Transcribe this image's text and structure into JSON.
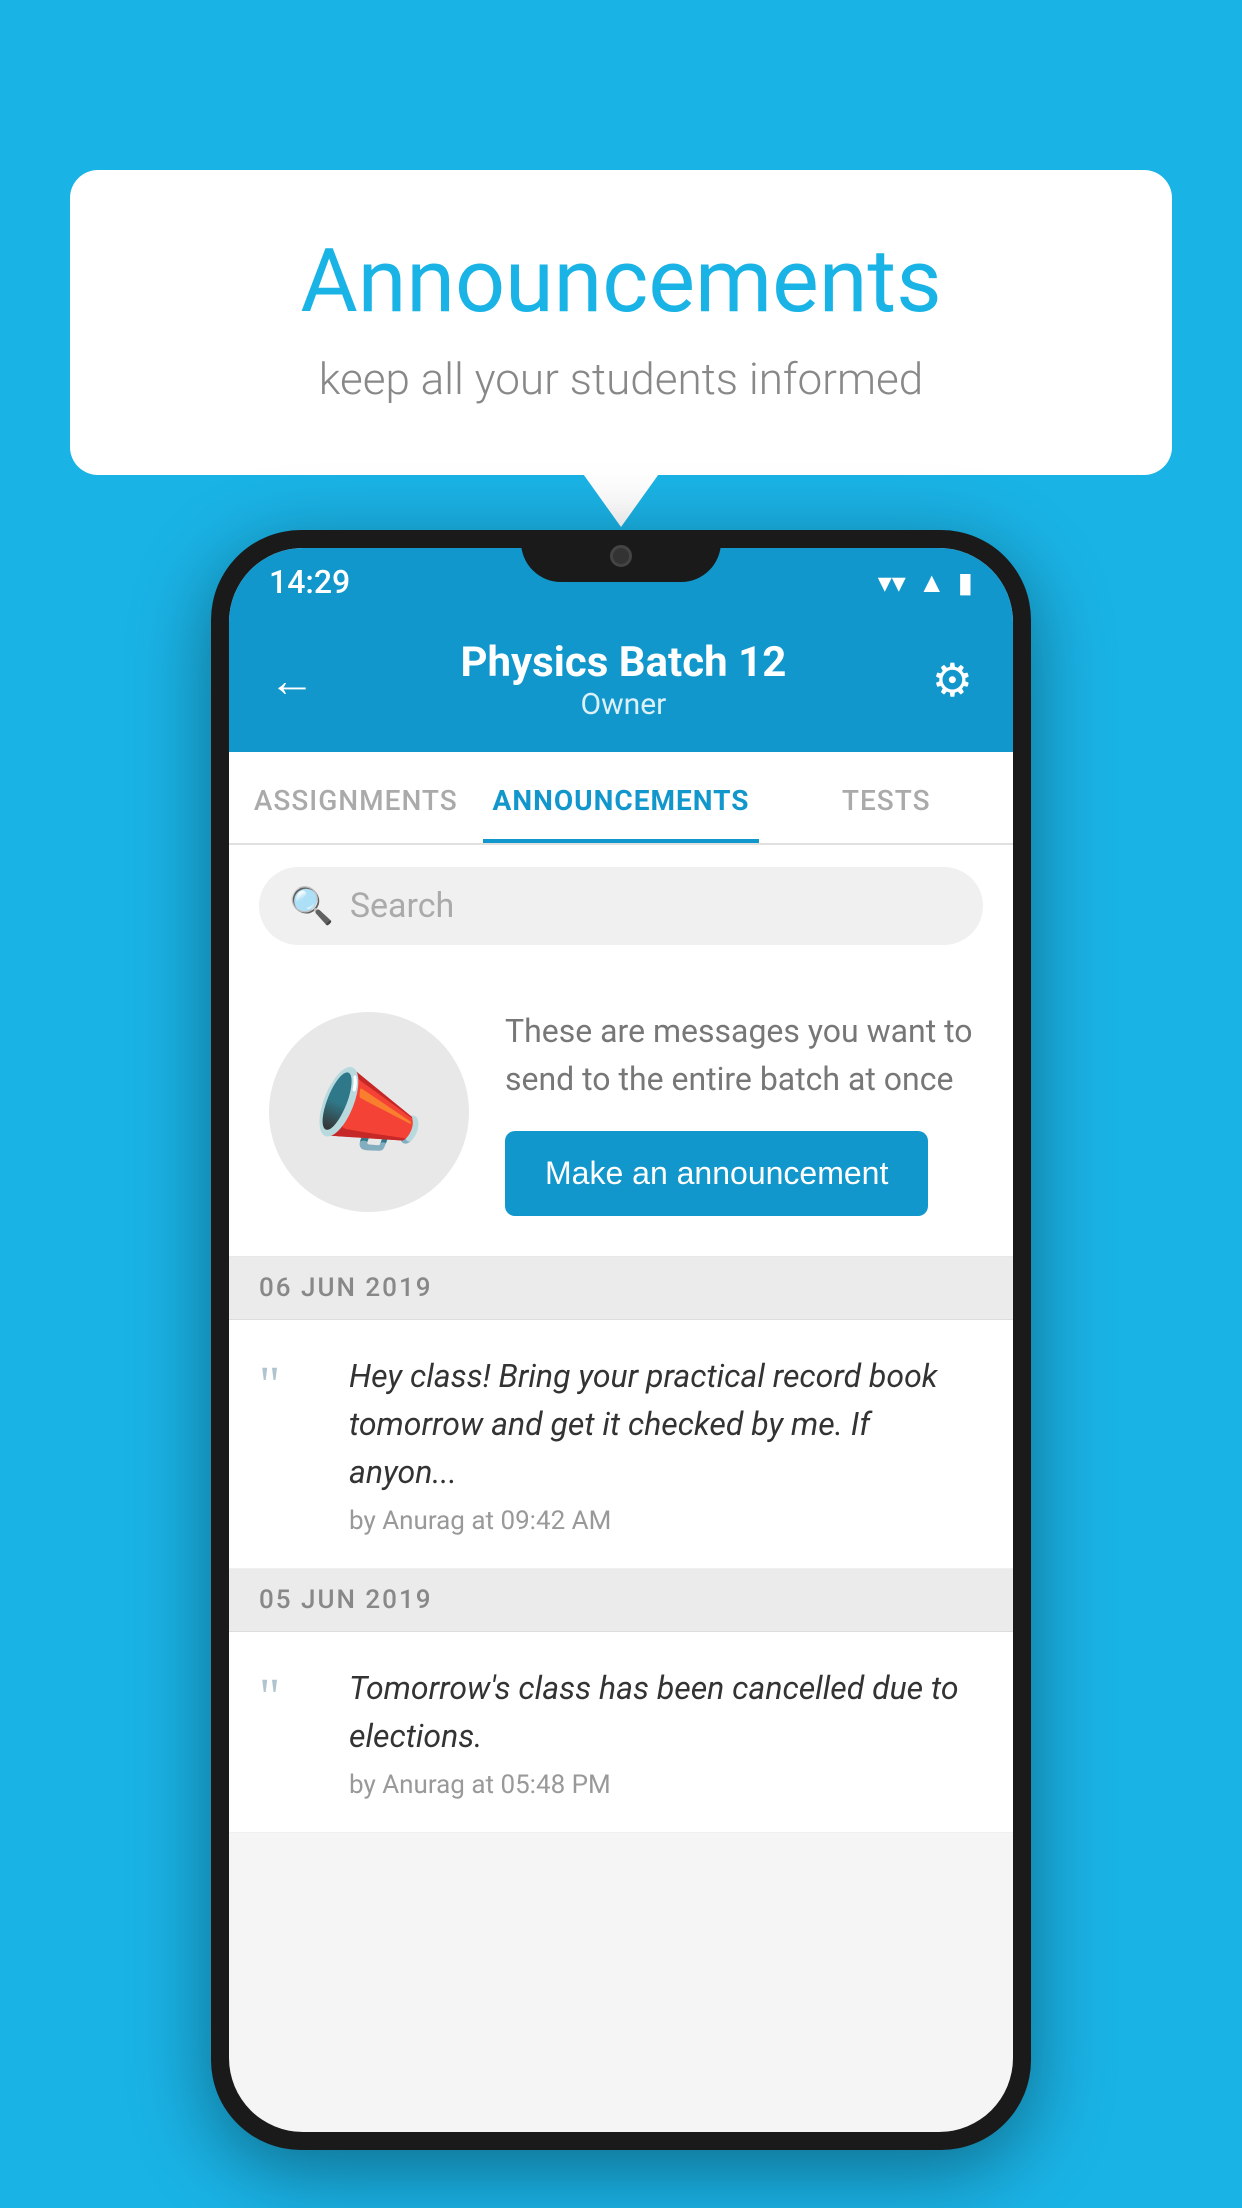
{
  "background_color": "#1ab3e6",
  "speech_bubble": {
    "title": "Announcements",
    "subtitle": "keep all your students informed"
  },
  "phone": {
    "status_bar": {
      "time": "14:29",
      "icons": [
        "wifi",
        "signal",
        "battery"
      ]
    },
    "header": {
      "back_icon": "←",
      "title": "Physics Batch 12",
      "subtitle": "Owner",
      "gear_icon": "⚙"
    },
    "tabs": [
      {
        "label": "ASSIGNMENTS",
        "active": false
      },
      {
        "label": "ANNOUNCEMENTS",
        "active": true
      },
      {
        "label": "TESTS",
        "active": false
      },
      {
        "label": "",
        "active": false
      }
    ],
    "search": {
      "placeholder": "Search"
    },
    "promo": {
      "description": "These are messages you want to send to the entire batch at once",
      "button_label": "Make an announcement"
    },
    "announcements": [
      {
        "date": "06  JUN  2019",
        "text": "Hey class! Bring your practical record book tomorrow and get it checked by me. If anyon...",
        "meta": "by Anurag at 09:42 AM"
      },
      {
        "date": "05  JUN  2019",
        "text": "Tomorrow's class has been cancelled due to elections.",
        "meta": "by Anurag at 05:48 PM"
      }
    ]
  }
}
